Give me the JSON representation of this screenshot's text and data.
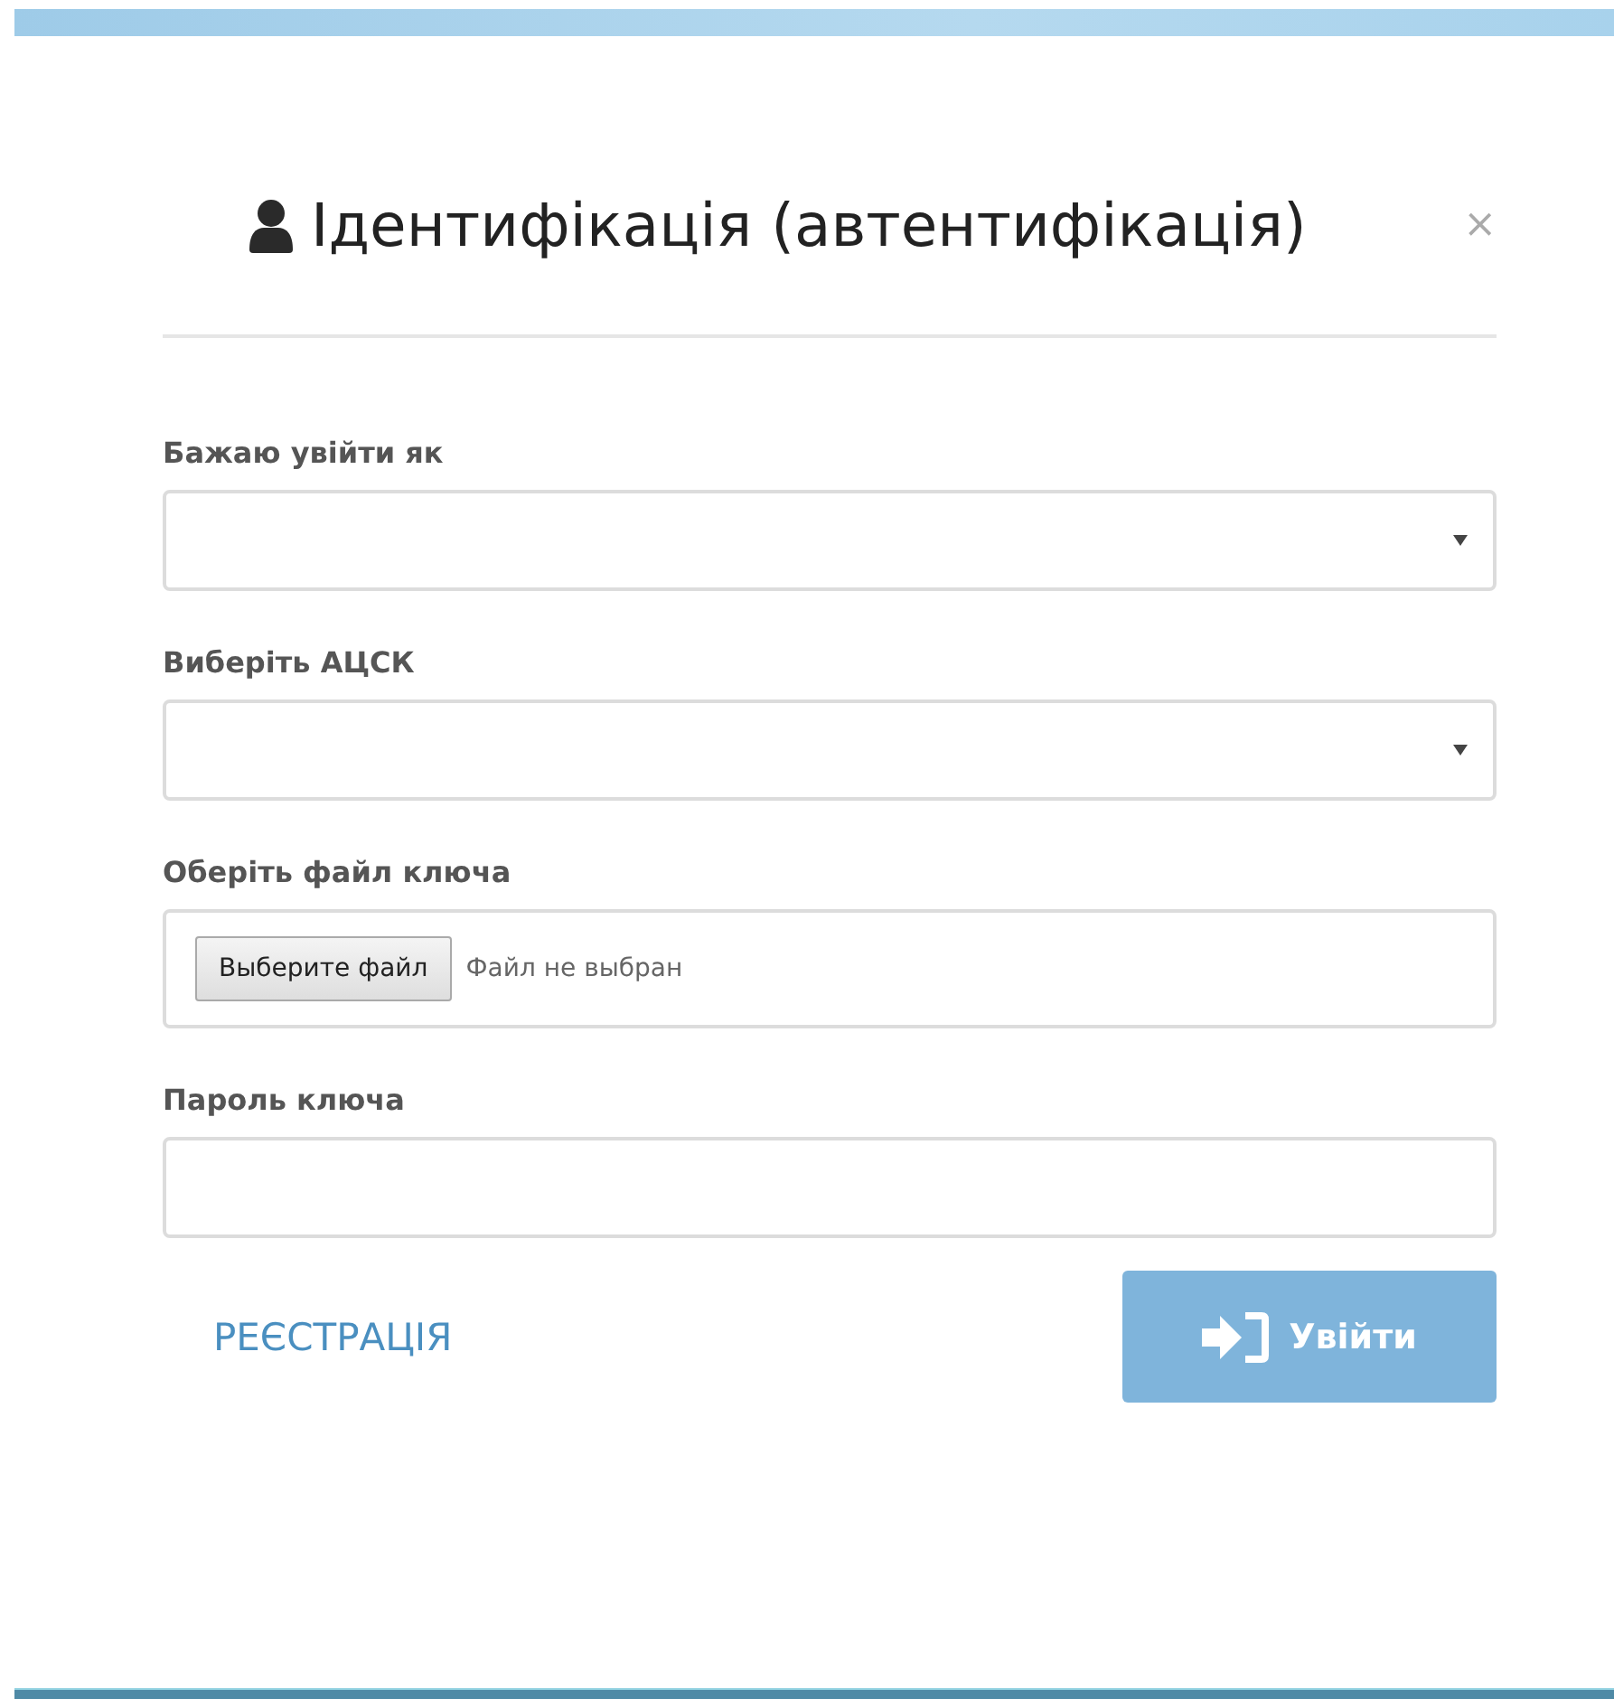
{
  "dialog": {
    "title": "Ідентифікація (автентифікація)",
    "close": "×"
  },
  "fields": [
    {
      "kind": "select",
      "label": "Бажаю увійти як"
    },
    {
      "kind": "select",
      "label": "Виберіть АЦСК"
    },
    {
      "kind": "file",
      "label": "Оберіть файл ключа",
      "button": "Выберите файл",
      "status": "Файл не выбран"
    },
    {
      "kind": "password",
      "label": "Пароль ключа"
    }
  ],
  "footer": {
    "link": "РЕЄСТРАЦІЯ",
    "submit": {
      "label": "Увійти",
      "disabled": true
    }
  }
}
